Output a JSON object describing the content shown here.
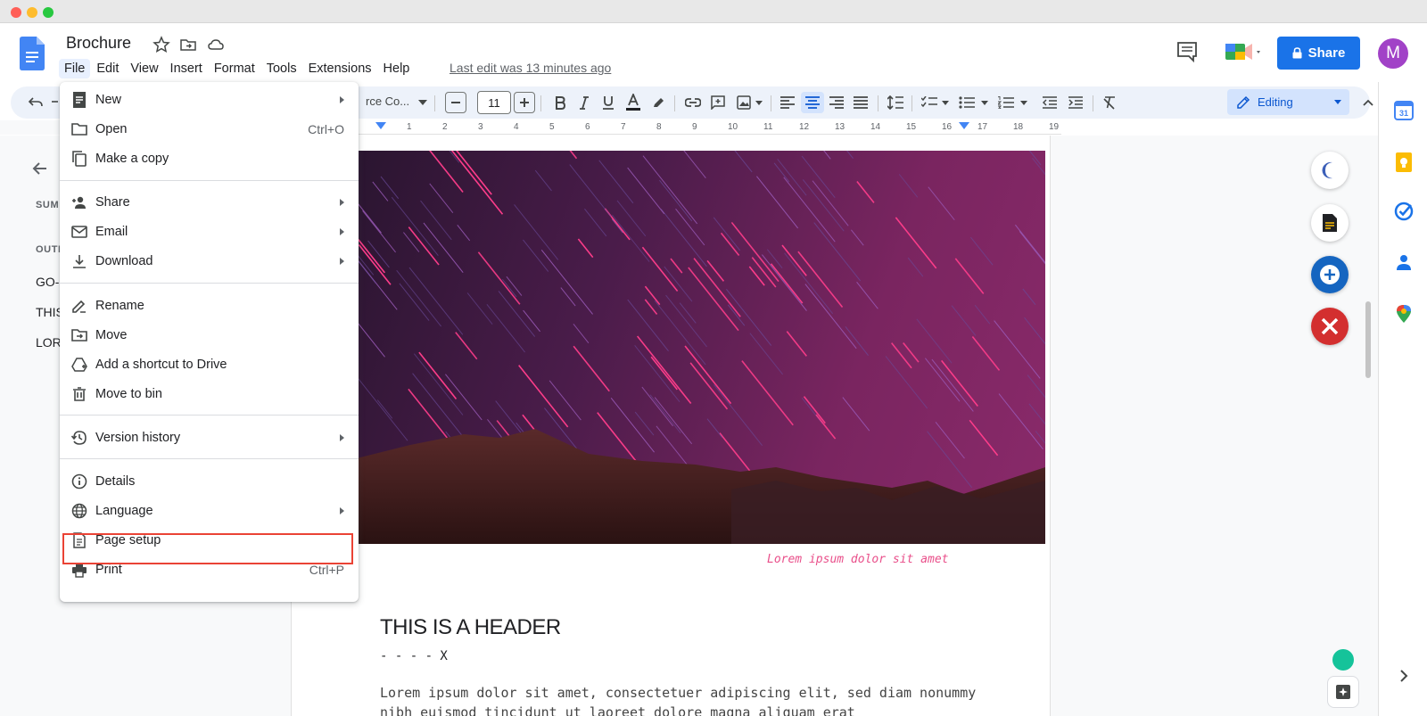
{
  "app": {
    "doc_title": "Brochure",
    "last_edit": "Last edit was 13 minutes ago",
    "share_label": "Share",
    "avatar_initial": "M"
  },
  "menubar": {
    "items": [
      "File",
      "Edit",
      "View",
      "Insert",
      "Format",
      "Tools",
      "Extensions",
      "Help"
    ],
    "active": "File"
  },
  "toolbar": {
    "font_name": "rce Co...",
    "font_size": "11",
    "mode_label": "Editing"
  },
  "ruler": {
    "numbers": [
      "1",
      "1",
      "2",
      "3",
      "4",
      "5",
      "6",
      "7",
      "8",
      "9",
      "10",
      "11",
      "12",
      "13",
      "14",
      "15",
      "16",
      "17",
      "18",
      "19"
    ]
  },
  "outline_panel": {
    "summary_label": "SUM",
    "outline_label": "OUTL",
    "items": [
      "GO-",
      "THIS",
      "LOR"
    ]
  },
  "document": {
    "caption": "Lorem ipsum dolor sit amet",
    "header": "THIS IS A HEADER",
    "dashes": "- - - - X",
    "body": "Lorem ipsum dolor sit amet, consectetuer adipiscing elit, sed diam nonummy nibh euismod tincidunt ut laoreet dolore magna aliquam erat"
  },
  "file_menu": {
    "groups": [
      [
        {
          "label": "New",
          "icon": "document-icon",
          "submenu": true
        },
        {
          "label": "Open",
          "icon": "folder-icon",
          "shortcut": "Ctrl+O"
        },
        {
          "label": "Make a copy",
          "icon": "copy-icon"
        }
      ],
      [
        {
          "label": "Share",
          "icon": "person-add-icon",
          "submenu": true
        },
        {
          "label": "Email",
          "icon": "mail-icon",
          "submenu": true
        },
        {
          "label": "Download",
          "icon": "download-icon",
          "submenu": true
        }
      ],
      [
        {
          "label": "Rename",
          "icon": "pencil-icon"
        },
        {
          "label": "Move",
          "icon": "move-folder-icon"
        },
        {
          "label": "Add a shortcut to Drive",
          "icon": "drive-shortcut-icon"
        },
        {
          "label": "Move to bin",
          "icon": "trash-icon"
        }
      ],
      [
        {
          "label": "Version history",
          "icon": "history-icon",
          "submenu": true
        }
      ],
      [
        {
          "label": "Details",
          "icon": "info-icon"
        },
        {
          "label": "Language",
          "icon": "globe-icon",
          "submenu": true
        },
        {
          "label": "Page setup",
          "icon": "page-icon",
          "highlighted": true
        },
        {
          "label": "Print",
          "icon": "print-icon",
          "shortcut": "Ctrl+P"
        }
      ]
    ]
  },
  "colors": {
    "accent": "#1a73e8",
    "highlight_border": "#ea4335",
    "caption": "#e94f8a",
    "avatar": "#a142c7"
  }
}
